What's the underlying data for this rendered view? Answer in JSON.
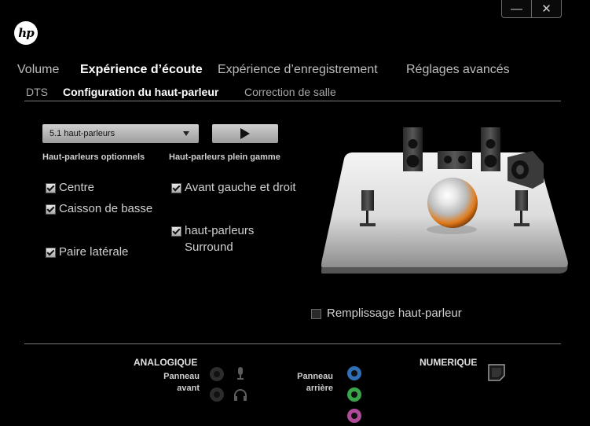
{
  "window": {
    "minimize": "—",
    "close": "✕"
  },
  "logo": "hp",
  "main_tabs": [
    "Volume",
    "Expérience d’écoute",
    "Expérience d’enregistrement",
    "Réglages avancés"
  ],
  "sub_tabs": [
    "DTS",
    "Configuration du haut-parleur",
    "Correction de salle"
  ],
  "speaker_config": {
    "selected": "5.1 haut-parleurs"
  },
  "optional": {
    "heading": "Haut-parleurs optionnels",
    "items": [
      {
        "label": "Centre",
        "checked": true
      },
      {
        "label": "Caisson de basse",
        "checked": true
      },
      {
        "label": "Paire latérale",
        "checked": true
      }
    ]
  },
  "fullrange": {
    "heading": "Haut-parleurs plein gamme",
    "items": [
      {
        "label": "Avant gauche et droit",
        "checked": true
      },
      {
        "label": "haut-parleurs",
        "label2": "Surround",
        "checked": true
      }
    ]
  },
  "fill": {
    "label": "Remplissage haut-parleur",
    "checked": false
  },
  "analog": {
    "title": "ANALOGIQUE",
    "front_panel_1": "Panneau",
    "front_panel_2": "avant",
    "rear_panel_1": "Panneau",
    "rear_panel_2": "arrière"
  },
  "digital": {
    "title": "NUMERIQUE"
  },
  "colors": {
    "accent_orange": "#e07a1a",
    "jack_blue": "#2f6fb5",
    "jack_green": "#3aa64a",
    "jack_pink": "#b04a9a"
  }
}
